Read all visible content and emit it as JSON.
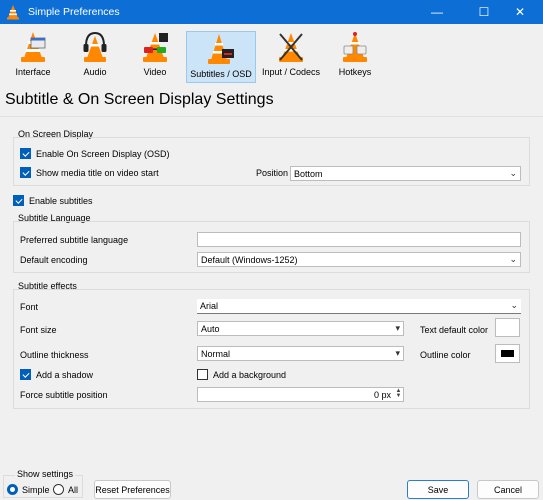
{
  "window": {
    "title": "Simple Preferences",
    "min_glyph": "—",
    "max_glyph": "☐",
    "close_glyph": "✕"
  },
  "tabs": [
    {
      "label": "Interface",
      "icon": "interface-cone-icon"
    },
    {
      "label": "Audio",
      "icon": "audio-headphones-icon"
    },
    {
      "label": "Video",
      "icon": "video-glasses-icon"
    },
    {
      "label": "Subtitles / OSD",
      "icon": "subtitles-cone-icon",
      "selected": true
    },
    {
      "label": "Input / Codecs",
      "icon": "input-cone-icon"
    },
    {
      "label": "Hotkeys",
      "icon": "hotkeys-cone-icon"
    }
  ],
  "page": {
    "title": "Subtitle & On Screen Display Settings"
  },
  "osd": {
    "group_label": "On Screen Display",
    "enable_osd": {
      "label": "Enable On Screen Display (OSD)",
      "checked": true
    },
    "show_title": {
      "label": "Show media title on video start",
      "checked": true
    },
    "position_label": "Position",
    "position_value": "Bottom"
  },
  "enable_subtitles": {
    "label": "Enable subtitles",
    "checked": true
  },
  "language": {
    "group_label": "Subtitle Language",
    "preferred_label": "Preferred subtitle language",
    "preferred_value": "",
    "encoding_label": "Default encoding",
    "encoding_value": "Default (Windows-1252)"
  },
  "effects": {
    "group_label": "Subtitle effects",
    "font_label": "Font",
    "font_value": "Arial",
    "font_size_label": "Font size",
    "font_size_value": "Auto",
    "text_color_label": "Text default color",
    "text_color": "#ffffff",
    "outline_thickness_label": "Outline thickness",
    "outline_thickness_value": "Normal",
    "outline_color_label": "Outline color",
    "outline_color": "#000000",
    "shadow": {
      "label": "Add a shadow",
      "checked": true
    },
    "background": {
      "label": "Add a background",
      "checked": false
    },
    "force_position_label": "Force subtitle position",
    "force_position_value": "0 px"
  },
  "footer": {
    "show_settings_label": "Show settings",
    "simple_label": "Simple",
    "all_label": "All",
    "reset_label": "Reset Preferences",
    "save_label": "Save",
    "cancel_label": "Cancel"
  },
  "colors": {
    "accent": "#005fb8",
    "titlebar": "#0d6fd6",
    "selected_tab": "#cce4f7"
  }
}
